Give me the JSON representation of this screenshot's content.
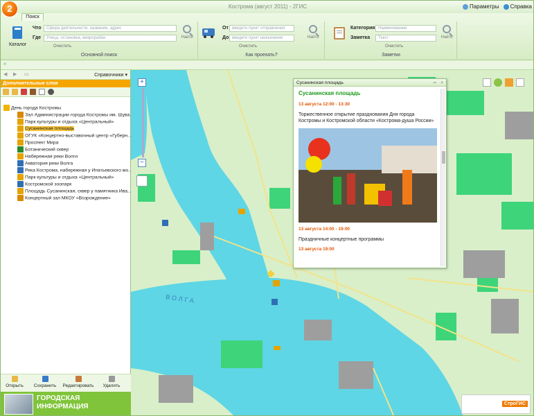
{
  "window": {
    "title": "Кострома (август 2011) - 2ГИС",
    "logo": "2",
    "params": "Параметры",
    "help": "Справка"
  },
  "ribbon": {
    "tab": "Поиск",
    "catalog": "Каталог",
    "what_label": "Что",
    "what_placeholder": "Сфера деятельности, название, адрес",
    "where_label": "Где",
    "where_placeholder": "Улица, остановка, микрорайон",
    "clear": "Очистить",
    "find": "Найти",
    "group_main": "Основной поиск",
    "from_label": "От",
    "from_placeholder": "введите пункт отправления",
    "to_label": "До",
    "to_placeholder": "введите пункт назначения",
    "group_route": "Как проехать?",
    "category_label": "Категория",
    "category_value": "Наименование",
    "note_label": "Заметка",
    "note_value": "Текст",
    "group_notes": "Заметки"
  },
  "left": {
    "reference": "Справочники",
    "layers_header": "Дополнительные слои",
    "tree": [
      {
        "label": "День города Костромы",
        "level": 0,
        "icon": "#f2b400"
      },
      {
        "label": "Зал Администрации города Костромы им. Шува...",
        "level": 1,
        "icon": "#d88a00"
      },
      {
        "label": "Парк культуры и отдыха «Центральный»",
        "level": 1,
        "icon": "#e4a400"
      },
      {
        "label": "Сусанинская площадь",
        "level": 1,
        "icon": "#e4a400",
        "selected": true
      },
      {
        "label": "ОГУК «Концертно-выставочный центр «Губерн...",
        "level": 1,
        "icon": "#e4a400"
      },
      {
        "label": "Проспект Мира",
        "level": 1,
        "icon": "#e4a400"
      },
      {
        "label": "Ботанический сквер",
        "level": 1,
        "icon": "#2a8a2a"
      },
      {
        "label": "Набережная реки Волги",
        "level": 1,
        "icon": "#e4a400"
      },
      {
        "label": "Акватория реки Волга",
        "level": 1,
        "icon": "#2f6fb5"
      },
      {
        "label": "Река Кострома, набережная у Ипатьевского мо...",
        "level": 1,
        "icon": "#2f6fb5"
      },
      {
        "label": "Парк культуры и отдыха «Центральный»",
        "level": 1,
        "icon": "#e4a400"
      },
      {
        "label": "Костромской зоопарк",
        "level": 1,
        "icon": "#2f6fb5"
      },
      {
        "label": "Площадь Сусанинская, сквер у памятника Ива...",
        "level": 1,
        "icon": "#e4a400"
      },
      {
        "label": "Концертный зал МКОУ «Возрождение»",
        "level": 1,
        "icon": "#d88a00"
      }
    ],
    "tools": {
      "open": "Открыть",
      "save": "Сохранить",
      "edit": "Редактировать",
      "delete": "Удалить"
    },
    "banner": "ГОРОДСКАЯ ИНФОРМАЦИЯ"
  },
  "popup": {
    "header": "Сусанинская площадь",
    "title": "Сусанинская площадь",
    "time1": "13 августа 12:00 - 13:30",
    "text1": "Торжественное открытие празднования Дня города Костромы и Костромской области «Кострома-душа России»",
    "time2": "13 августа 14:00 - 19:00",
    "text2": "Праздничные концертные программы",
    "time3": "13 августа 19:00"
  },
  "map": {
    "river_label": "ВОЛГА",
    "logo": "СтроГИС"
  },
  "colors": {
    "water": "#5ed6e5",
    "land": "#d9efc9",
    "green": "#3ed47a",
    "buildings": "#9e9e9e",
    "accent": "#f5a500"
  }
}
